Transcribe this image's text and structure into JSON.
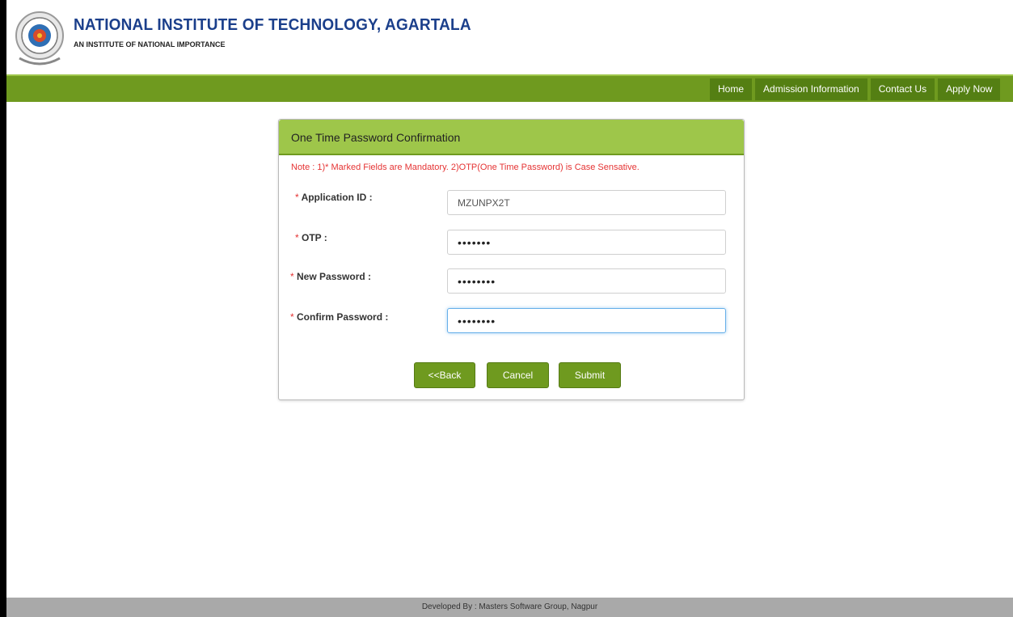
{
  "header": {
    "title": "NATIONAL INSTITUTE OF TECHNOLOGY, AGARTALA",
    "subtitle": "AN INSTITUTE OF NATIONAL IMPORTANCE",
    "logo_icon": "institute-seal-icon"
  },
  "nav": {
    "items": [
      {
        "label": "Home"
      },
      {
        "label": "Admission Information"
      },
      {
        "label": "Contact Us"
      },
      {
        "label": "Apply Now"
      }
    ]
  },
  "panel": {
    "title": "One Time Password Confirmation",
    "note": "Note : 1)* Marked Fields are Mandatory. 2)OTP(One Time Password) is Case Sensative.",
    "fields": {
      "application_id": {
        "label": "Application ID :",
        "value": "MZUNPX2T"
      },
      "otp": {
        "label": "OTP :",
        "value": "•••••••"
      },
      "new_password": {
        "label": "New Password :",
        "value": "••••••••"
      },
      "confirm_password": {
        "label": "Confirm Password :",
        "value": "••••••••"
      }
    },
    "required_mark": "*",
    "buttons": {
      "back": "<<Back",
      "cancel": "Cancel",
      "submit": "Submit"
    }
  },
  "footer": {
    "text": "Developed By : Masters Software Group, Nagpur"
  },
  "colors": {
    "nav_green": "#6f9a1f",
    "panel_header": "#9ec64a",
    "title_blue": "#1b3f8b",
    "note_red": "#e53333"
  }
}
